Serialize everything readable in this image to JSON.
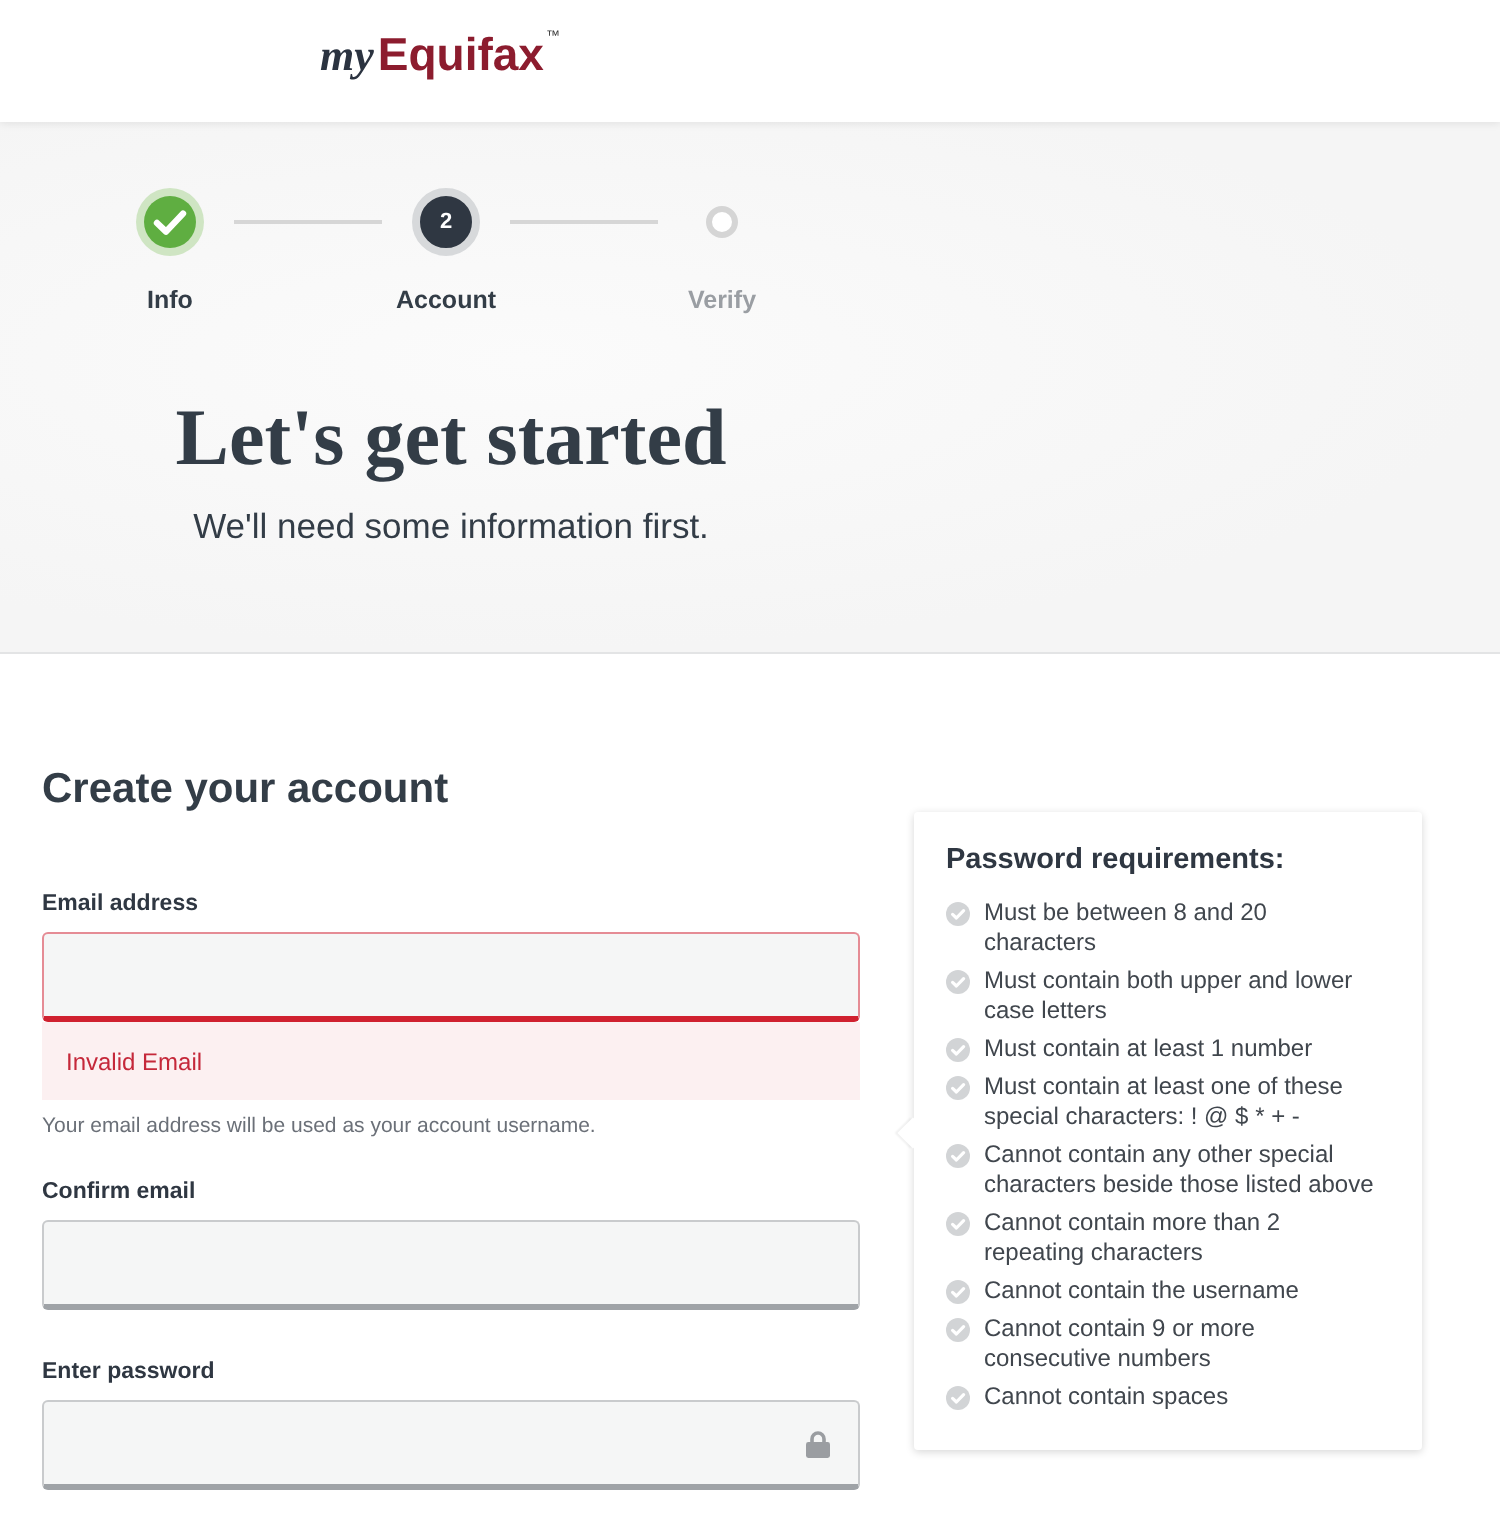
{
  "header": {
    "logo": {
      "prefix": "my",
      "name": "Equifax",
      "mark": "™"
    }
  },
  "stepper": {
    "steps": [
      {
        "label": "Info",
        "completed": true,
        "selected": false
      },
      {
        "label": "Account",
        "number": "2",
        "completed": false,
        "selected": true
      },
      {
        "label": "Verify",
        "completed": false,
        "selected": false
      }
    ]
  },
  "hero": {
    "title": "Let's get started",
    "subtitle": "We'll need some information first."
  },
  "form": {
    "title": "Create your account",
    "fields": [
      {
        "kind": "email",
        "label": "Email address",
        "invalid": true,
        "error": "Invalid Email",
        "help": "Your email address will be used as your account username."
      },
      {
        "kind": "email",
        "label": "Confirm email",
        "invalid": false
      },
      {
        "kind": "password",
        "label": "Enter password",
        "invalid": false
      }
    ]
  },
  "password_requirements": {
    "title": "Password requirements:",
    "items": [
      {
        "text": "Must be between 8 and 20 characters",
        "met": false
      },
      {
        "text": "Must contain both upper and lower case letters",
        "met": false
      },
      {
        "text": "Must contain at least 1 number",
        "met": false
      },
      {
        "text": "Must contain at least one of these special characters: ! @ $ * + -",
        "met": false
      },
      {
        "text": "Cannot contain any other special characters beside those listed above",
        "met": false
      },
      {
        "text": "Cannot contain more than 2 repeating characters",
        "met": false
      },
      {
        "text": "Cannot contain the username",
        "met": false
      },
      {
        "text": "Cannot contain 9 or more consecutive numbers",
        "met": false
      },
      {
        "text": "Cannot contain spaces",
        "met": false
      }
    ]
  }
}
